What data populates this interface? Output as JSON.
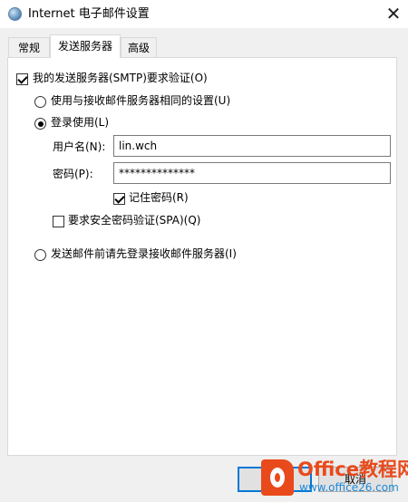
{
  "window": {
    "title": "Internet 电子邮件设置",
    "close_glyph": "✕"
  },
  "tabs": [
    {
      "label": "常规"
    },
    {
      "label": "发送服务器"
    },
    {
      "label": "高级"
    }
  ],
  "smtp_auth": {
    "label": "我的发送服务器(SMTP)要求验证(O)",
    "checked": true
  },
  "same_settings": {
    "label": "使用与接收邮件服务器相同的设置(U)",
    "selected": false
  },
  "login_with": {
    "label": "登录使用(L)",
    "selected": true
  },
  "username": {
    "label": "用户名(N):",
    "value": "lin.wch"
  },
  "password": {
    "label": "密码(P):",
    "value": "**************"
  },
  "remember_password": {
    "label": "记住密码(R)",
    "checked": true
  },
  "spa": {
    "label": "要求安全密码验证(SPA)(Q)",
    "checked": false
  },
  "login_before_send": {
    "label": "发送邮件前请先登录接收邮件服务器(I)",
    "selected": false
  },
  "buttons": {
    "ok": "",
    "cancel": "取消"
  },
  "watermark": {
    "title": "Office教程网",
    "url": "www.office26.com"
  }
}
